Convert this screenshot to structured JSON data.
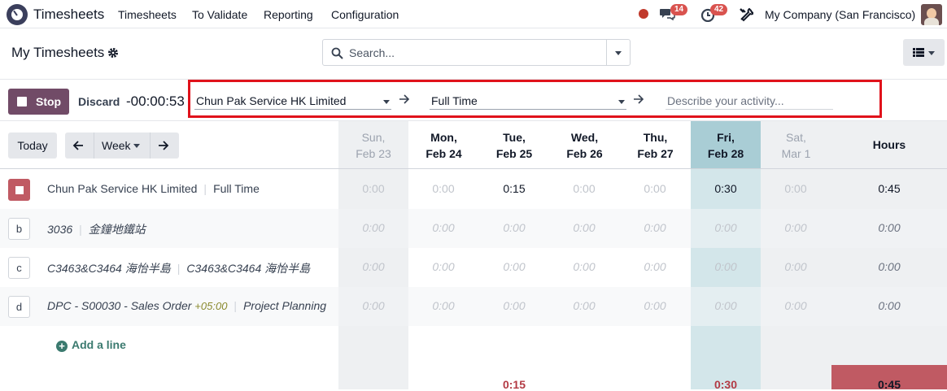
{
  "navbar": {
    "app_name": "Timesheets",
    "menu": [
      "Timesheets",
      "To Validate",
      "Reporting",
      "Configuration"
    ],
    "messages_count": "14",
    "activities_count": "42",
    "company": "My Company (San Francisco)"
  },
  "control_panel": {
    "title": "My Timesheets",
    "search_placeholder": "Search..."
  },
  "timer": {
    "stop_label": "Stop",
    "discard_label": "Discard",
    "elapsed": "-00:00:53",
    "project": "Chun Pak Service HK Limited",
    "task": "Full Time",
    "description_placeholder": "Describe your activity..."
  },
  "grid": {
    "today_label": "Today",
    "range_label": "Week",
    "hours_header": "Hours",
    "days": [
      {
        "name": "Sun,",
        "date": "Feb 23"
      },
      {
        "name": "Mon,",
        "date": "Feb 24"
      },
      {
        "name": "Tue,",
        "date": "Feb 25"
      },
      {
        "name": "Wed,",
        "date": "Feb 26"
      },
      {
        "name": "Thu,",
        "date": "Feb 27"
      },
      {
        "name": "Fri,",
        "date": "Feb 28"
      },
      {
        "name": "Sat,",
        "date": "Mar 1"
      }
    ],
    "rows": [
      {
        "key": "",
        "project": "Chun Pak Service HK Limited",
        "task": "Full Time",
        "cells": [
          "0:00",
          "0:00",
          "0:15",
          "0:00",
          "0:00",
          "0:30",
          "0:00"
        ],
        "total": "0:45"
      },
      {
        "key": "b",
        "project": "3036",
        "task": "金鐘地鐵站",
        "cells": [
          "0:00",
          "0:00",
          "0:00",
          "0:00",
          "0:00",
          "0:00",
          "0:00"
        ],
        "total": "0:00"
      },
      {
        "key": "c",
        "project": "C3463&C3464 海怡半島",
        "task": "C3463&C3464 海怡半島",
        "cells": [
          "0:00",
          "0:00",
          "0:00",
          "0:00",
          "0:00",
          "0:00",
          "0:00"
        ],
        "total": "0:00"
      },
      {
        "key": "d",
        "project": "DPC - S00030 - Sales Order",
        "timezone": "+05:00",
        "task": "Project Planning",
        "cells": [
          "0:00",
          "0:00",
          "0:00",
          "0:00",
          "0:00",
          "0:00",
          "0:00"
        ],
        "total": "0:00"
      }
    ],
    "add_line_label": "Add a line",
    "day_totals": {
      "tue": "0:15",
      "fri": "0:30"
    },
    "grand_total": "0:45"
  },
  "colors": {
    "accent": "#714b67",
    "today_column": "#d3e6ea",
    "overtime": "#c05a63",
    "highlight": "#e0121b"
  }
}
